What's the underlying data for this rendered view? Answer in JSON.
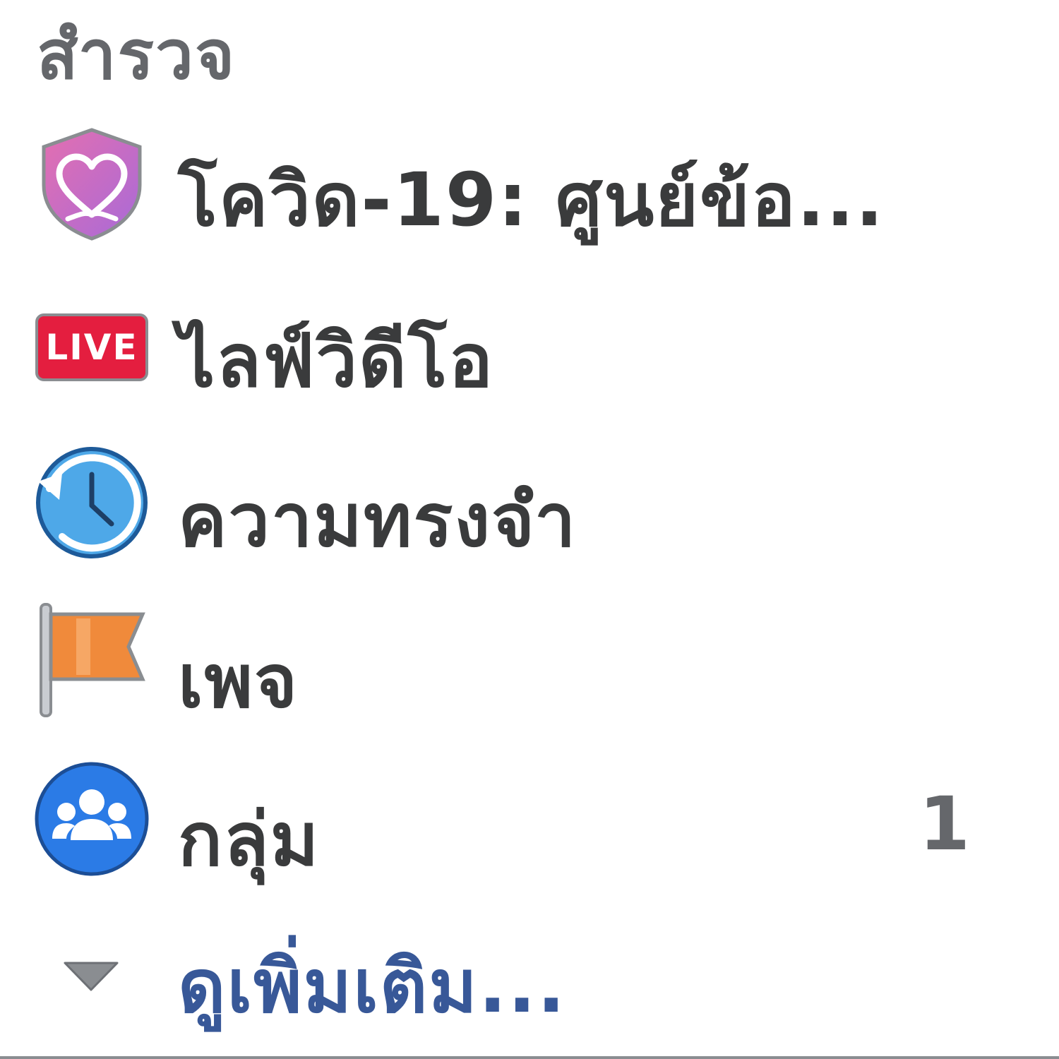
{
  "section": {
    "title": "สำรวจ"
  },
  "items": [
    {
      "label": "โควิด-19: ศูนย์ข้อ...",
      "icon": "covid-shield-heart-icon",
      "count": ""
    },
    {
      "label": "ไลฟ์วิดีโอ",
      "icon": "live-icon",
      "icon_text": "LIVE",
      "count": ""
    },
    {
      "label": "ความทรงจำ",
      "icon": "memories-clock-icon",
      "count": ""
    },
    {
      "label": "เพจ",
      "icon": "flag-icon",
      "count": ""
    },
    {
      "label": "กลุ่ม",
      "icon": "groups-icon",
      "count": "1"
    }
  ],
  "see_more": {
    "label": "ดูเพิ่มเติม...",
    "icon": "chevron-down-icon"
  },
  "colors": {
    "covid_shield": "#d46fbf",
    "live_red": "#e41e3f",
    "memories_blue": "#4ea8e8",
    "flag_orange": "#f08a3b",
    "groups_blue": "#1877f2",
    "see_more_text": "#385898",
    "label_text": "#3a3b3c",
    "muted_text": "#65676b"
  }
}
